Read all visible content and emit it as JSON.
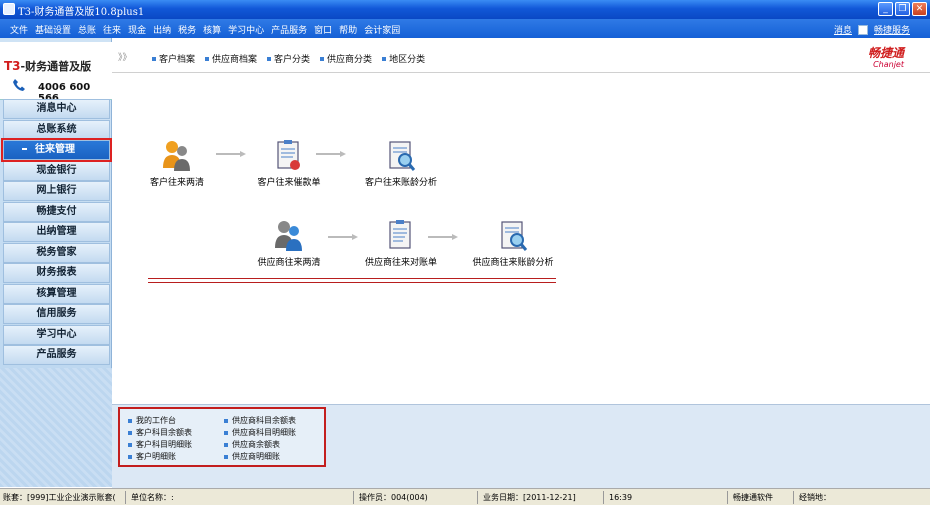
{
  "window": {
    "title": "T3-财务通普及版10.8plus1"
  },
  "menu": {
    "items": [
      "文件",
      "基础设置",
      "总账",
      "往来",
      "现金",
      "出纳",
      "税务",
      "核算",
      "学习中心",
      "产品服务",
      "窗口",
      "帮助",
      "会计家园"
    ],
    "right_links": [
      "消息",
      "畅捷服务"
    ]
  },
  "sidebar": {
    "brand_prefix": "T3",
    "brand_suffix": "-财务通普及版",
    "phone": "4006 600 566",
    "items": [
      {
        "label": "消息中心"
      },
      {
        "label": "总账系统"
      },
      {
        "label": "往来管理",
        "active": true
      },
      {
        "label": "现金银行"
      },
      {
        "label": "网上银行"
      },
      {
        "label": "畅捷支付"
      },
      {
        "label": "出纳管理"
      },
      {
        "label": "税务管家"
      },
      {
        "label": "财务报表"
      },
      {
        "label": "核算管理"
      },
      {
        "label": "信用服务"
      },
      {
        "label": "学习中心"
      },
      {
        "label": "产品服务"
      }
    ]
  },
  "toolbar": {
    "chevron": "》》",
    "tabs": [
      "客户档案",
      "供应商档案",
      "客户分类",
      "供应商分类",
      "地区分类"
    ],
    "logo_cn": "畅捷通",
    "logo_en": "Chanjet"
  },
  "flow": {
    "row1": [
      "客户往来两清",
      "客户往来催款单",
      "客户往来账龄分析"
    ],
    "row2": [
      "供应商往来两清",
      "供应商往来对账单",
      "供应商往来账龄分析"
    ]
  },
  "quick_links": {
    "col1": [
      "我的工作台",
      "客户科目余额表",
      "客户科目明细账",
      "客户明细账"
    ],
    "col2": [
      "供应商科目余额表",
      "供应商科目明细账",
      "供应商余额表",
      "供应商明细账"
    ]
  },
  "status": {
    "account": "账套：[999]工业企业演示账套(",
    "unit": "单位名称：:",
    "operator": "操作员：004(004)",
    "date": "业务日期：[2011-12-21]",
    "time": "16:39",
    "vendor": "畅捷通软件",
    "dealer": "经销地："
  },
  "colors": {
    "accent": "#1560d6",
    "highlight_border": "#c31e1e",
    "brand_red": "#d01e1e"
  }
}
